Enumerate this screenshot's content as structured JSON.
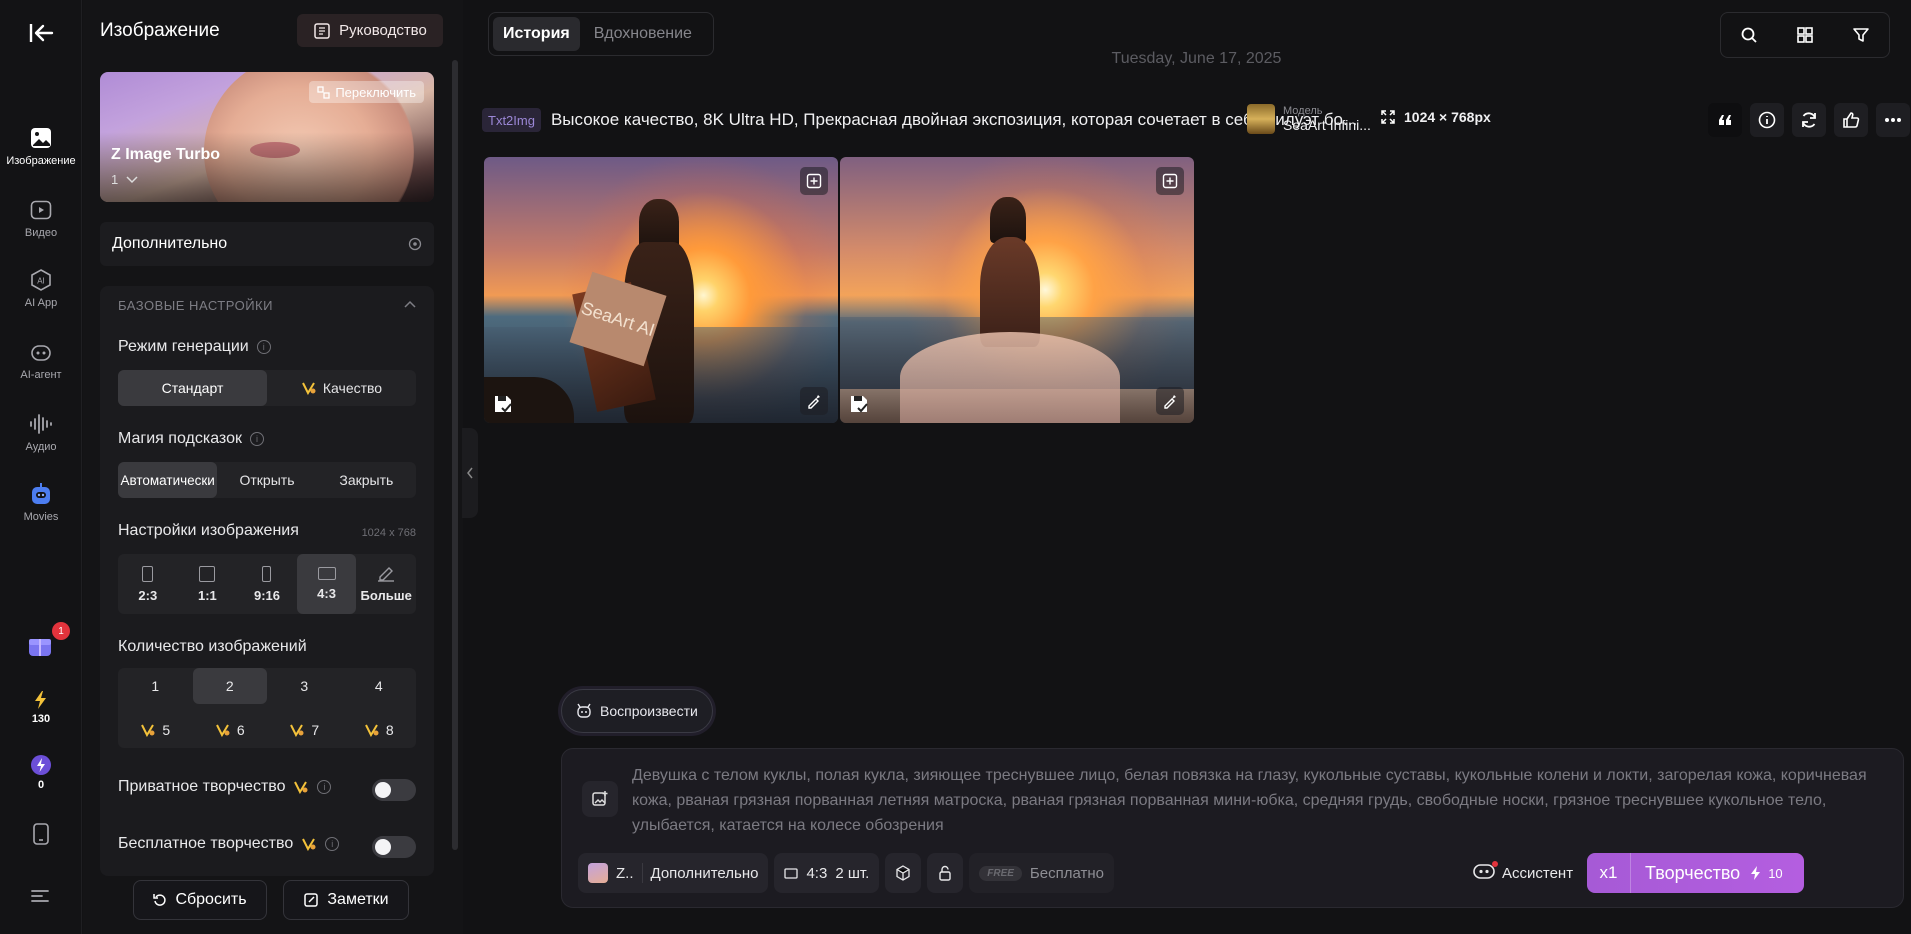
{
  "rail": {
    "items": [
      {
        "label": "Изображение"
      },
      {
        "label": "Видео"
      },
      {
        "label": "AI App"
      },
      {
        "label": "AI-агент"
      },
      {
        "label": "Аудио"
      },
      {
        "label": "Movies"
      }
    ],
    "notification_count": "1",
    "credits": "130",
    "bonus": "0"
  },
  "panel": {
    "title": "Изображение",
    "guide_label": "Руководство",
    "model": {
      "switch_label": "Переключить",
      "name": "Z Image Turbo",
      "version": "1"
    },
    "advanced_label": "Дополнительно",
    "base_settings_label": "БАЗОВЫЕ НАСТРОЙКИ",
    "gen_mode": {
      "label": "Режим генерации",
      "options": [
        "Стандарт",
        "Качество"
      ],
      "selected": "Стандарт"
    },
    "prompt_magic": {
      "label": "Магия подсказок",
      "options": [
        "Автоматически",
        "Открыть",
        "Закрыть"
      ],
      "selected": "Автоматически"
    },
    "image_settings": {
      "label": "Настройки изображения",
      "size": "1024 x 768",
      "ratios": [
        "2:3",
        "1:1",
        "9:16",
        "4:3",
        "Больше"
      ],
      "selected": "4:3"
    },
    "image_count": {
      "label": "Количество изображений",
      "row1": [
        "1",
        "2",
        "3",
        "4"
      ],
      "row2": [
        "5",
        "6",
        "7",
        "8"
      ],
      "selected": "2"
    },
    "private_label": "Приватное творчество",
    "free_label": "Бесплатное творчество",
    "reset_label": "Сбросить",
    "notes_label": "Заметки"
  },
  "main": {
    "tabs": [
      "История",
      "Вдохновение"
    ],
    "selected_tab": "История",
    "date": "Tuesday, June 17, 2025",
    "record": {
      "tag": "Txt2Img",
      "prompt": "Высокое качество, 8K Ultra HD, Прекрасная двойная экспозиция, которая сочетает в себе силуэт бо...",
      "model_label": "Модель",
      "model_name": "SeaArt Infini...",
      "dimensions": "1024 × 768px",
      "sign_text": "SeaArt AI"
    },
    "play_label": "Воспроизвести",
    "composer": {
      "text": "Девушка с телом куклы, полая кукла, зияющее треснувшее лицо, белая повязка на глазу, кукольные суставы, кукольные колени и локти, загорелая кожа, коричневая кожа, рваная грязная порванная летняя матроска, рваная грязная порванная мини-юбка, средняя грудь, свободные носки, грязное треснувшее кукольное тело, улыбается, катается на колесе обозрения",
      "model_short": "Z..",
      "advanced": "Дополнительно",
      "ratio": "4:3",
      "count": "2 шт.",
      "free_badge": "FREE",
      "free_label": "Бесплатно",
      "assistant": "Ассистент",
      "multiplier": "x1",
      "create_label": "Творчество",
      "cost": "10"
    }
  }
}
